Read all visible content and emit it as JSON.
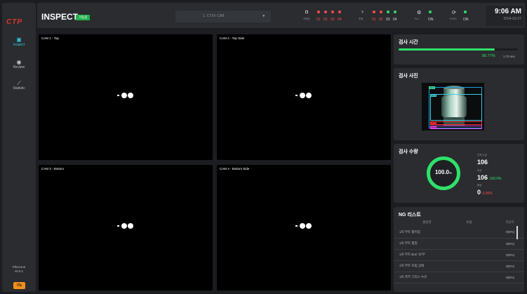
{
  "sidebar": {
    "logo": "CTP",
    "items": [
      {
        "label": "Inspect",
        "icon": "image-icon",
        "active": true
      },
      {
        "label": "Review",
        "icon": "eye-icon",
        "active": false
      },
      {
        "label": "Statistic",
        "icon": "chart-icon",
        "active": false
      }
    ],
    "brand": "Pikozone",
    "version": "v0.0.1",
    "bottom_badge": "ITa"
  },
  "header": {
    "title": "INSPECT",
    "mode_tag": "가동중",
    "model_select": "1. CTXX CAB",
    "camera": {
      "label": "카메라",
      "nums": [
        "01",
        "02",
        "03",
        "04"
      ],
      "colors": [
        "#ff4b4b",
        "#ff4b4b",
        "#ff4b4b",
        "#ff4b4b"
      ]
    },
    "light": {
      "label": "조명",
      "nums": [
        "01",
        "02",
        "03",
        "04"
      ],
      "colors": [
        "#ff4b4b",
        "#ff4b4b",
        "#2fe06a",
        "#2fe06a"
      ],
      "text_colors": [
        "#ff4b4b",
        "#ff4b4b",
        "#d6d8da",
        "#d6d8da"
      ]
    },
    "plc": {
      "label": "PLC",
      "value": "ON"
    },
    "sync": {
      "label": "SYNC",
      "value": "ON"
    },
    "time": "9:06 AM",
    "date": "2024-03-27"
  },
  "cams": [
    {
      "label": "CAM 1 - Top"
    },
    {
      "label": "CAM 2 - Top Side"
    },
    {
      "label": "CAM 3 - Bottom"
    },
    {
      "label": "CAM 4 - Bottom Side"
    }
  ],
  "inspect_time": {
    "title": "검사 시간",
    "progress": 0.8077,
    "percent_text": "80.77%",
    "seconds_text": "1.70 sec"
  },
  "inspect_photo": {
    "title": "검사 사진",
    "boxes": [
      "cam1",
      "cam2",
      "cam3",
      "cam4"
    ]
  },
  "inspect_qty": {
    "title": "검사 수량",
    "ring_value": "100.0",
    "ring_unit": "%",
    "total_label": "전체 수량",
    "total": "106",
    "ok_label": "정상",
    "ok": "106",
    "ok_pct": "100.0%",
    "ng_label": "불량",
    "ng": "0",
    "ng_pct": "0.00%"
  },
  "ng_list": {
    "title": "NG 리스트",
    "headers": [
      "불량명",
      "비율",
      "카운트"
    ],
    "rows": [
      {
        "name": "1차 부트 찢어짐",
        "ratio": "",
        "count": "0(0%)"
      },
      {
        "name": "1차 부트 찢힘",
        "ratio": "",
        "count": "0(0%)"
      },
      {
        "name": "1차 부트 Burr 유/무",
        "ratio": "",
        "count": "0(0%)"
      },
      {
        "name": "1차 부트 조립 상태",
        "ratio": "",
        "count": "0(0%)"
      },
      {
        "name": "1차 측부 그리스 누유",
        "ratio": "",
        "count": "0(0%)"
      }
    ]
  }
}
